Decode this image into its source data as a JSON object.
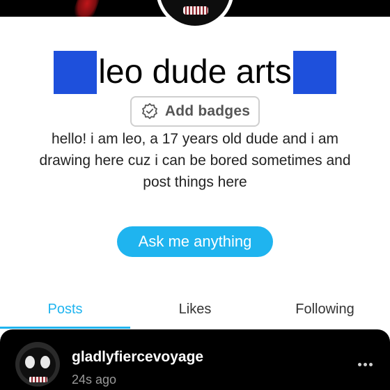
{
  "profile": {
    "title": "leo dude arts",
    "title_accent_color": "#1e50dc",
    "badges_button": {
      "label": "Add badges",
      "icon": "badge-icon"
    },
    "bio_lines": [
      "hello! i am leo, a 17 years old dude and i am",
      "drawing here cuz i can be bored sometimes and",
      "post things here"
    ],
    "ask_button": {
      "label": "Ask me anything",
      "color": "#1fb4ef"
    }
  },
  "tabs": [
    {
      "label": "Posts",
      "active": true
    },
    {
      "label": "Likes",
      "active": false
    },
    {
      "label": "Following",
      "active": false
    }
  ],
  "post": {
    "username": "gladlyfiercevoyage",
    "time": "24s ago",
    "more_icon": "more-dots-icon"
  }
}
